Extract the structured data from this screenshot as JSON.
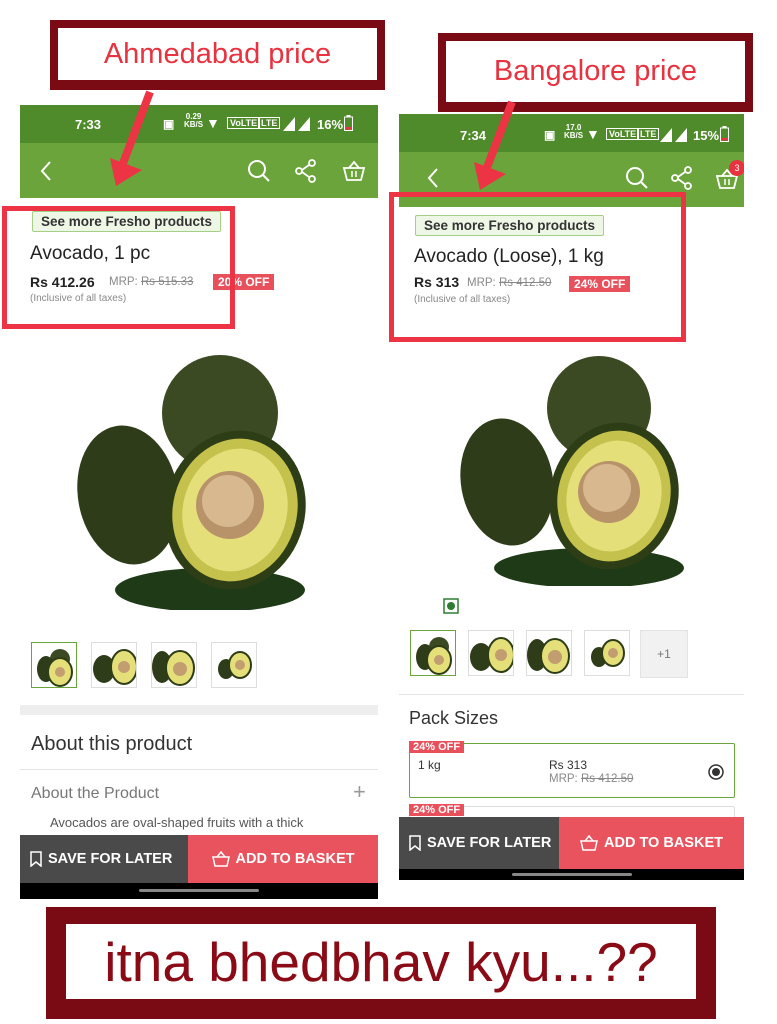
{
  "captions": {
    "left": "Ahmedabad price",
    "right": "Bangalore price",
    "bottom": "itna bhedbhav kyu...??"
  },
  "colors": {
    "brand_green": "#6aa43a",
    "status_green": "#4f8a2b",
    "accent_red": "#e8535d",
    "caption_maroon": "#7a0a14"
  },
  "left_screen": {
    "status": {
      "time": "7:33",
      "net_speed": "0.29",
      "net_unit": "KB/S",
      "battery": "16%"
    },
    "brand_chip": "See more Fresho products",
    "product_name": "Avocado, 1 pc",
    "price": "Rs 412.26",
    "mrp_label": "MRP:",
    "mrp_value": "Rs 515.33",
    "discount": "20% OFF",
    "taxes_note": "(Inclusive of all taxes)",
    "about_title": "About this product",
    "about_sub": "About the Product",
    "about_text": "Avocados are oval-shaped fruits with a thick",
    "save_label": "SAVE FOR LATER",
    "add_label": "ADD TO BASKET"
  },
  "right_screen": {
    "status": {
      "time": "7:34",
      "net_speed": "17.0",
      "net_unit": "KB/S",
      "battery": "15%"
    },
    "cart_count": "3",
    "brand_chip": "See more Fresho products",
    "product_name": "Avocado (Loose), 1 kg",
    "price": "Rs 313",
    "mrp_label": "MRP:",
    "mrp_value": "Rs 412.50",
    "discount": "24% OFF",
    "taxes_note": "(Inclusive of all taxes)",
    "more_thumbs": "+1",
    "pack_sizes_title": "Pack Sizes",
    "packs": [
      {
        "tag": "24% OFF",
        "size": "1 kg",
        "price": "Rs 313",
        "mrp_label": "MRP:",
        "mrp": "Rs 412.50"
      },
      {
        "tag": "24% OFF"
      }
    ],
    "save_label": "SAVE FOR LATER",
    "add_label": "ADD TO BASKET"
  }
}
